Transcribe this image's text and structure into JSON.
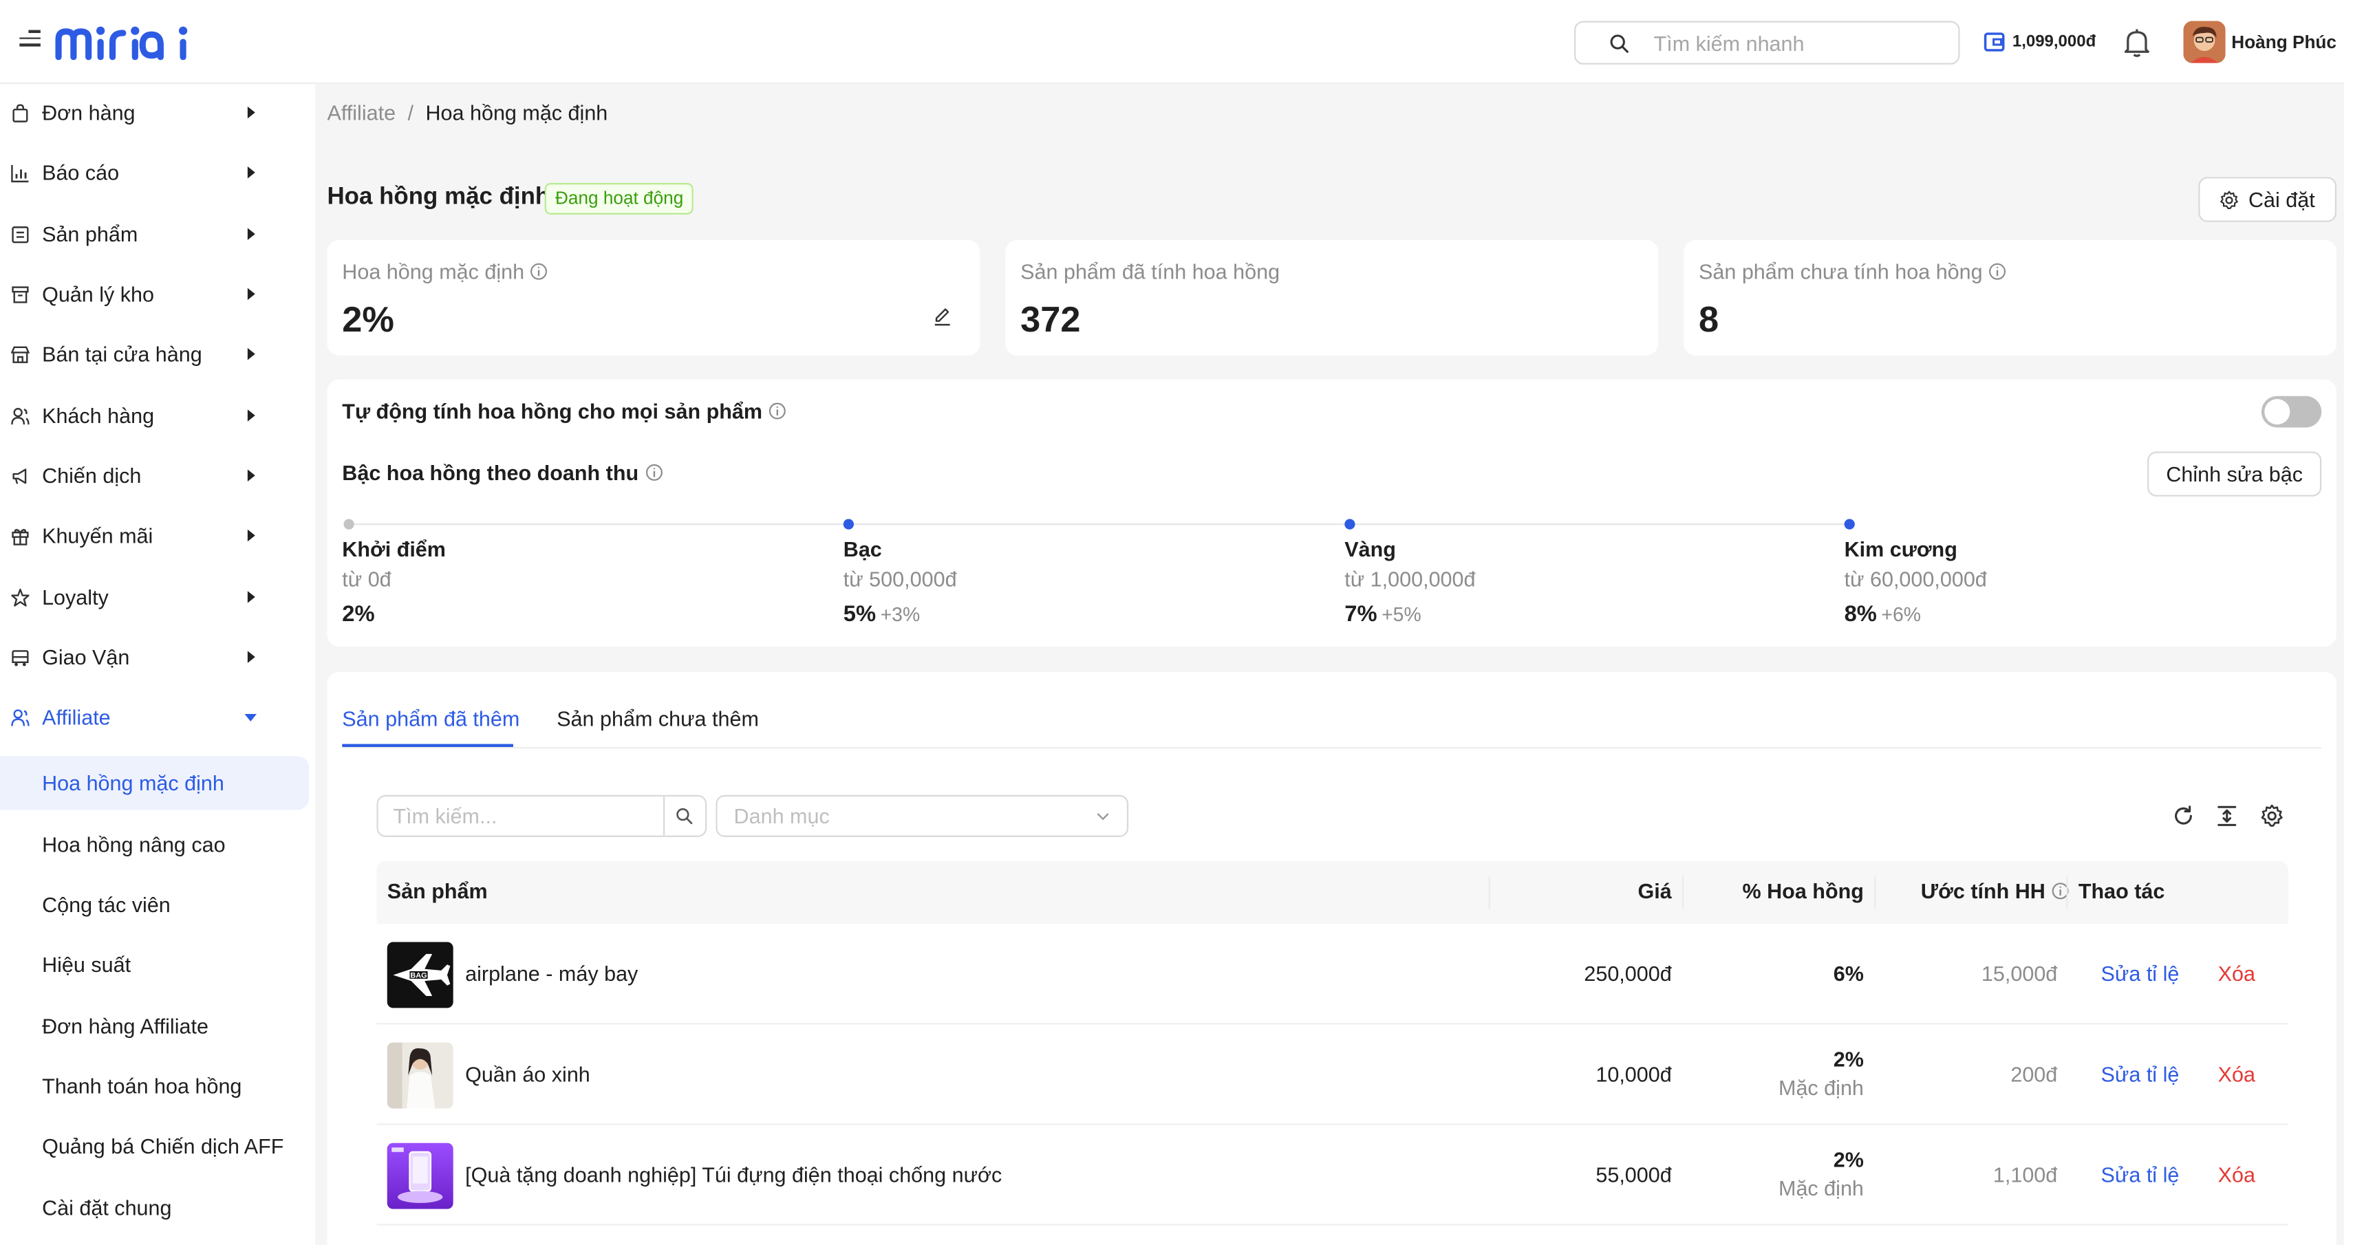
{
  "header": {
    "search_placeholder": "Tìm kiếm nhanh",
    "wallet_amount": "1,099,000đ",
    "username": "Hoàng Phúc"
  },
  "sidebar": {
    "items": [
      {
        "label": "Đơn hàng",
        "icon": "bag-icon"
      },
      {
        "label": "Báo cáo",
        "icon": "chart-icon"
      },
      {
        "label": "Sản phẩm",
        "icon": "box-icon"
      },
      {
        "label": "Quản lý kho",
        "icon": "warehouse-icon"
      },
      {
        "label": "Bán tại cửa hàng",
        "icon": "store-icon"
      },
      {
        "label": "Khách hàng",
        "icon": "users-icon"
      },
      {
        "label": "Chiến dịch",
        "icon": "megaphone-icon"
      },
      {
        "label": "Khuyến mãi",
        "icon": "gift-icon"
      },
      {
        "label": "Loyalty",
        "icon": "star-icon"
      },
      {
        "label": "Giao Vận",
        "icon": "truck-icon"
      },
      {
        "label": "Affiliate",
        "icon": "affiliate-icon"
      }
    ],
    "subitems": [
      "Hoa hồng mặc định",
      "Hoa hồng nâng cao",
      "Cộng tác viên",
      "Hiệu suất",
      "Đơn hàng Affiliate",
      "Thanh toán hoa hồng",
      "Quảng bá Chiến dịch AFF",
      "Cài đặt chung"
    ]
  },
  "breadcrumb": {
    "root": "Affiliate",
    "sep": "/",
    "current": "Hoa hồng mặc định"
  },
  "page": {
    "title": "Hoa hồng mặc định",
    "status": "Đang hoạt động",
    "settings_label": "Cài đặt"
  },
  "stats": {
    "default_label": "Hoa hồng mặc định",
    "default_value": "2%",
    "counted_label": "Sản phẩm đã tính hoa hồng",
    "counted_value": "372",
    "uncounted_label": "Sản phẩm chưa tính hoa hồng",
    "uncounted_value": "8"
  },
  "auto": {
    "label": "Tự động tính hoa hồng cho mọi sản phẩm",
    "enabled": false
  },
  "tiers": {
    "title": "Bậc hoa hồng theo doanh thu",
    "edit_label": "Chỉnh sửa bậc",
    "list": [
      {
        "name": "Khởi điểm",
        "from": "từ 0đ",
        "rate": "2%",
        "plus": ""
      },
      {
        "name": "Bạc",
        "from": "từ 500,000đ",
        "rate": "5%",
        "plus": "+3%"
      },
      {
        "name": "Vàng",
        "from": "từ 1,000,000đ",
        "rate": "7%",
        "plus": "+5%"
      },
      {
        "name": "Kim cương",
        "from": "từ 60,000,000đ",
        "rate": "8%",
        "plus": "+6%"
      }
    ]
  },
  "tabs": {
    "added": "Sản phẩm đã thêm",
    "not_added": "Sản phẩm chưa thêm"
  },
  "filters": {
    "search_placeholder": "Tìm kiếm...",
    "category_placeholder": "Danh mục"
  },
  "table": {
    "headers": {
      "product": "Sản phẩm",
      "price": "Giá",
      "rate": "% Hoa hồng",
      "estimate": "Ước tính HH",
      "actions": "Thao tác"
    },
    "rows": [
      {
        "name": "airplane - máy bay",
        "price": "250,000đ",
        "rate": "6%",
        "rate_note": "",
        "estimate": "15,000đ",
        "edit": "Sửa tỉ lệ",
        "delete": "Xóa"
      },
      {
        "name": "Quần áo xinh",
        "price": "10,000đ",
        "rate": "2%",
        "rate_note": "Mặc định",
        "estimate": "200đ",
        "edit": "Sửa tỉ lệ",
        "delete": "Xóa"
      },
      {
        "name": "[Quà tặng doanh nghiệp] Túi đựng điện thoại chống nước",
        "price": "55,000đ",
        "rate": "2%",
        "rate_note": "Mặc định",
        "estimate": "1,100đ",
        "edit": "Sửa tỉ lệ",
        "delete": "Xóa"
      }
    ]
  },
  "colors": {
    "accent": "#2d5be3",
    "danger": "#e53935",
    "success": "#389e0d"
  }
}
